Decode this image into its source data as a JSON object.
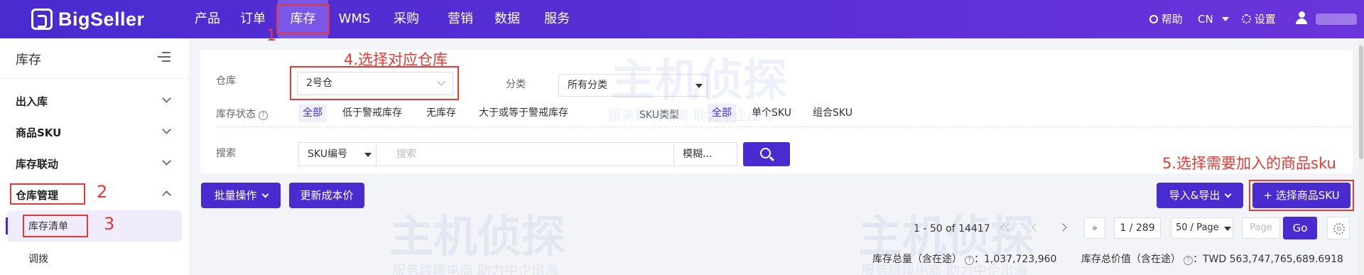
{
  "brand": {
    "name": "BigSeller"
  },
  "nav": {
    "items": [
      {
        "label": "产品"
      },
      {
        "label": "订单"
      },
      {
        "label": "库存"
      },
      {
        "label": "WMS"
      },
      {
        "label": "采购"
      },
      {
        "label": "营销"
      },
      {
        "label": "数据"
      },
      {
        "label": "服务"
      }
    ],
    "active": "库存",
    "help": "帮助",
    "lang": "CN",
    "settings": "设置"
  },
  "sidebar": {
    "title": "库存",
    "groups": [
      {
        "label": "出入库",
        "expanded": false
      },
      {
        "label": "商品SKU",
        "expanded": false
      },
      {
        "label": "库存联动",
        "expanded": false
      },
      {
        "label": "仓库管理",
        "expanded": true
      }
    ],
    "subitems": [
      {
        "label": "库存清单",
        "active": true
      },
      {
        "label": "调拨",
        "active": false
      }
    ]
  },
  "filters": {
    "warehouse_label": "仓库",
    "warehouse_value": "2号仓",
    "category_label": "分类",
    "category_value": "所有分类",
    "stock_status_label": "库存状态",
    "stock_status_options": [
      "全部",
      "低于警戒库存",
      "无库存",
      "大于或等于警戒库存"
    ],
    "stock_status_selected": "全部",
    "sku_type_label": "SKU类型",
    "sku_type_options": [
      "全部",
      "单个SKU",
      "组合SKU"
    ],
    "sku_type_selected": "全部",
    "search_label": "搜索",
    "search_field": "SKU编号",
    "search_placeholder": "搜索",
    "search_mode": "模糊..."
  },
  "annotations": {
    "n1": "1",
    "n2": "2",
    "n3": "3",
    "step4": "4.选择对应仓库",
    "step5": "5.选择需要加入的商品sku"
  },
  "actions": {
    "bulk": "批量操作",
    "update_cost": "更新成本价",
    "import_export": "导入&导出",
    "select_sku": "+ 选择商品SKU"
  },
  "pagination": {
    "range": "1 - 50 of 14417",
    "page": "1 / 289",
    "page_size": "50 / Page",
    "page_placeholder": "Page",
    "go": "Go"
  },
  "totals": {
    "qty_label": "库存总量（含在途）",
    "qty_value": "1,037,723,960",
    "value_label": "库存总价值（含在途）",
    "value_value": "TWD 563,747,765,689.6918"
  },
  "watermark": {
    "main": "主机侦探",
    "sub": "服务跨境电商 助力中企出海"
  }
}
